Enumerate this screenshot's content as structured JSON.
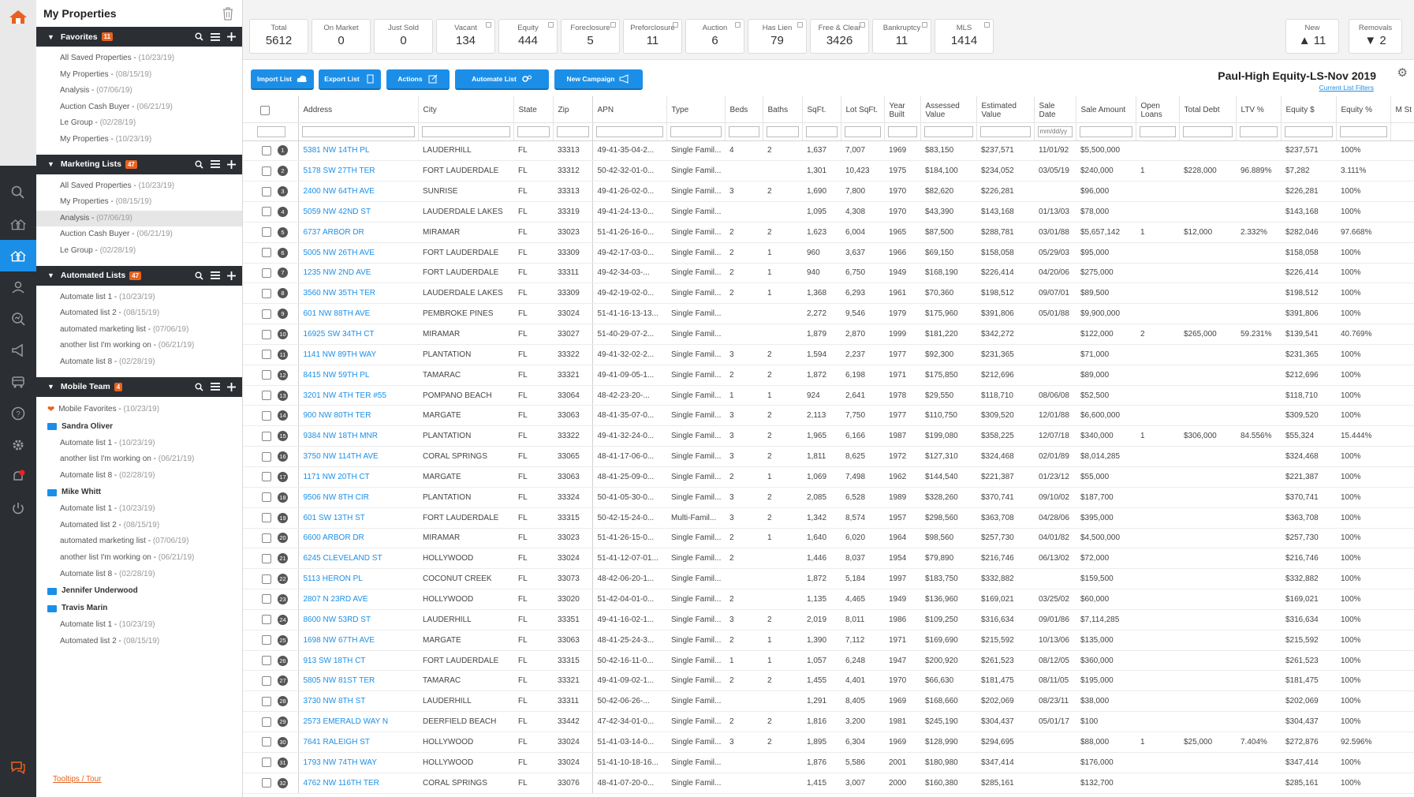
{
  "sidebar": {
    "title": "My Properties",
    "favorites": {
      "label": "Favorites",
      "badge": "11",
      "items": [
        {
          "name": "All Saved Properties",
          "date": "(10/23/19)"
        },
        {
          "name": "My Properties",
          "date": "(08/15/19)"
        },
        {
          "name": "Analysis",
          "date": "(07/06/19)"
        },
        {
          "name": "Auction Cash Buyer",
          "date": "(06/21/19)"
        },
        {
          "name": "Le Group",
          "date": "(02/28/19)"
        },
        {
          "name": "My Properties",
          "date": "(10/23/19)"
        }
      ]
    },
    "marketing": {
      "label": "Marketing Lists",
      "badge": "47",
      "items": [
        {
          "name": "All Saved Properties",
          "date": "(10/23/19)"
        },
        {
          "name": "My Properties",
          "date": "(08/15/19)"
        },
        {
          "name": "Analysis",
          "date": "(07/06/19)"
        },
        {
          "name": "Auction Cash Buyer",
          "date": "(06/21/19)"
        },
        {
          "name": "Le Group",
          "date": "(02/28/19)"
        }
      ]
    },
    "automated": {
      "label": "Automated Lists",
      "badge": "47",
      "items": [
        {
          "name": "Automate list 1",
          "date": "(10/23/19)"
        },
        {
          "name": "Automated list 2",
          "date": "(08/15/19)"
        },
        {
          "name": "automated marketing list",
          "date": "(07/06/19)"
        },
        {
          "name": "another list I'm working on",
          "date": "(06/21/19)"
        },
        {
          "name": "Automate list 8",
          "date": "(02/28/19)"
        }
      ]
    },
    "mobile": {
      "label": "Mobile Team",
      "badge": "4",
      "favorites": {
        "name": "Mobile Favorites",
        "date": "(10/23/19)"
      },
      "members": [
        {
          "name": "Sandra Oliver",
          "items": [
            {
              "name": "Automate list 1",
              "date": "(10/23/19)"
            },
            {
              "name": "another list I'm working on",
              "date": "(06/21/19)"
            },
            {
              "name": "Automate list 8",
              "date": "(02/28/19)"
            }
          ]
        },
        {
          "name": "Mike Whitt",
          "items": [
            {
              "name": "Automate list 1",
              "date": "(10/23/19)"
            },
            {
              "name": "Automated list 2",
              "date": "(08/15/19)"
            },
            {
              "name": "automated marketing list",
              "date": "(07/06/19)"
            },
            {
              "name": "another list I'm working on",
              "date": "(06/21/19)"
            },
            {
              "name": "Automate list 8",
              "date": "(02/28/19)"
            }
          ]
        },
        {
          "name": "Jennifer Underwood",
          "items": []
        },
        {
          "name": "Travis Marin",
          "items": [
            {
              "name": "Automate list 1",
              "date": "(10/23/19)"
            },
            {
              "name": "Automated list 2",
              "date": "(08/15/19)"
            }
          ]
        }
      ]
    },
    "tooltips": "Tooltips / Tour"
  },
  "stats": [
    {
      "label": "Total",
      "value": "5612",
      "ext": false
    },
    {
      "label": "On Market",
      "value": "0",
      "ext": false
    },
    {
      "label": "Just Sold",
      "value": "0",
      "ext": false
    },
    {
      "label": "Vacant",
      "value": "134",
      "ext": true
    },
    {
      "label": "Equity",
      "value": "444",
      "ext": true
    },
    {
      "label": "Foreclosure",
      "value": "5",
      "ext": true
    },
    {
      "label": "Preforclosure",
      "value": "11",
      "ext": true
    },
    {
      "label": "Auction",
      "value": "6",
      "ext": true
    },
    {
      "label": "Has Lien",
      "value": "79",
      "ext": true
    },
    {
      "label": "Free & Clear",
      "value": "3426",
      "ext": true
    },
    {
      "label": "Bankruptcy",
      "value": "11",
      "ext": true
    },
    {
      "label": "MLS",
      "value": "1414",
      "ext": true
    }
  ],
  "new_stat": {
    "label": "New",
    "value": "11",
    "arrow": "▲"
  },
  "removals_stat": {
    "label": "Removals",
    "value": "2",
    "arrow": "▼"
  },
  "toolbar": {
    "import": "Import List",
    "export": "Export List",
    "actions": "Actions",
    "automate": "Automate List",
    "campaign": "New Campaign",
    "list_title": "Paul-High Equity-LS-Nov 2019",
    "filters_link": "Current List Filters"
  },
  "columns": [
    "Address",
    "City",
    "State",
    "Zip",
    "APN",
    "Type",
    "Beds",
    "Baths",
    "SqFt.",
    "Lot SqFt.",
    "Year Built",
    "Assessed Value",
    "Estimated Value",
    "Sale Date",
    "Sale Amount",
    "Open Loans",
    "Total Debt",
    "LTV %",
    "Equity $",
    "Equity %",
    "M St"
  ],
  "filter_placeholder_sale_date": "mm/dd/yy",
  "rows": [
    [
      "1",
      "5381 NW 14TH PL",
      "LAUDERHILL",
      "FL",
      "33313",
      "49-41-35-04-2...",
      "Single Famil...",
      "4",
      "2",
      "1,637",
      "7,007",
      "1969",
      "$83,150",
      "$237,571",
      "11/01/92",
      "$5,500,000",
      "",
      "",
      "",
      "$237,571",
      "100%"
    ],
    [
      "2",
      "5178 SW 27TH TER",
      "FORT LAUDERDALE",
      "FL",
      "33312",
      "50-42-32-01-0...",
      "Single Famil...",
      "",
      "",
      "1,301",
      "10,423",
      "1975",
      "$184,100",
      "$234,052",
      "03/05/19",
      "$240,000",
      "1",
      "$228,000",
      "96.889%",
      "$7,282",
      "3.111%"
    ],
    [
      "3",
      "2400 NW 64TH AVE",
      "SUNRISE",
      "FL",
      "33313",
      "49-41-26-02-0...",
      "Single Famil...",
      "3",
      "2",
      "1,690",
      "7,800",
      "1970",
      "$82,620",
      "$226,281",
      "",
      "$96,000",
      "",
      "",
      "",
      "$226,281",
      "100%"
    ],
    [
      "4",
      "5059 NW 42ND ST",
      "LAUDERDALE LAKES",
      "FL",
      "33319",
      "49-41-24-13-0...",
      "Single Famil...",
      "",
      "",
      "1,095",
      "4,308",
      "1970",
      "$43,390",
      "$143,168",
      "01/13/03",
      "$78,000",
      "",
      "",
      "",
      "$143,168",
      "100%"
    ],
    [
      "5",
      "6737 ARBOR DR",
      "MIRAMAR",
      "FL",
      "33023",
      "51-41-26-16-0...",
      "Single Famil...",
      "2",
      "2",
      "1,623",
      "6,004",
      "1965",
      "$87,500",
      "$288,781",
      "03/01/88",
      "$5,657,142",
      "1",
      "$12,000",
      "2.332%",
      "$282,046",
      "97.668%"
    ],
    [
      "6",
      "5005 NW 26TH AVE",
      "FORT LAUDERDALE",
      "FL",
      "33309",
      "49-42-17-03-0...",
      "Single Famil...",
      "2",
      "1",
      "960",
      "3,637",
      "1966",
      "$69,150",
      "$158,058",
      "05/29/03",
      "$95,000",
      "",
      "",
      "",
      "$158,058",
      "100%"
    ],
    [
      "7",
      "1235 NW 2ND AVE",
      "FORT LAUDERDALE",
      "FL",
      "33311",
      "49-42-34-03-...",
      "Single Famil...",
      "2",
      "1",
      "940",
      "6,750",
      "1949",
      "$168,190",
      "$226,414",
      "04/20/06",
      "$275,000",
      "",
      "",
      "",
      "$226,414",
      "100%"
    ],
    [
      "8",
      "3560 NW 35TH TER",
      "LAUDERDALE LAKES",
      "FL",
      "33309",
      "49-42-19-02-0...",
      "Single Famil...",
      "2",
      "1",
      "1,368",
      "6,293",
      "1961",
      "$70,360",
      "$198,512",
      "09/07/01",
      "$89,500",
      "",
      "",
      "",
      "$198,512",
      "100%"
    ],
    [
      "9",
      "601 NW 88TH AVE",
      "PEMBROKE PINES",
      "FL",
      "33024",
      "51-41-16-13-13...",
      "Single Famil...",
      "",
      "",
      "2,272",
      "9,546",
      "1979",
      "$175,960",
      "$391,806",
      "05/01/88",
      "$9,900,000",
      "",
      "",
      "",
      "$391,806",
      "100%"
    ],
    [
      "10",
      "16925 SW 34TH CT",
      "MIRAMAR",
      "FL",
      "33027",
      "51-40-29-07-2...",
      "Single Famil...",
      "",
      "",
      "1,879",
      "2,870",
      "1999",
      "$181,220",
      "$342,272",
      "",
      "$122,000",
      "2",
      "$265,000",
      "59.231%",
      "$139,541",
      "40.769%"
    ],
    [
      "11",
      "1141 NW 89TH WAY",
      "PLANTATION",
      "FL",
      "33322",
      "49-41-32-02-2...",
      "Single Famil...",
      "3",
      "2",
      "1,594",
      "2,237",
      "1977",
      "$92,300",
      "$231,365",
      "",
      "$71,000",
      "",
      "",
      "",
      "$231,365",
      "100%"
    ],
    [
      "12",
      "8415 NW 59TH PL",
      "TAMARAC",
      "FL",
      "33321",
      "49-41-09-05-1...",
      "Single Famil...",
      "2",
      "2",
      "1,872",
      "6,198",
      "1971",
      "$175,850",
      "$212,696",
      "",
      "$89,000",
      "",
      "",
      "",
      "$212,696",
      "100%"
    ],
    [
      "13",
      "3201 NW 4TH TER #55",
      "POMPANO BEACH",
      "FL",
      "33064",
      "48-42-23-20-...",
      "Single Famil...",
      "1",
      "1",
      "924",
      "2,641",
      "1978",
      "$29,550",
      "$118,710",
      "08/06/08",
      "$52,500",
      "",
      "",
      "",
      "$118,710",
      "100%"
    ],
    [
      "14",
      "900 NW 80TH TER",
      "MARGATE",
      "FL",
      "33063",
      "48-41-35-07-0...",
      "Single Famil...",
      "3",
      "2",
      "2,113",
      "7,750",
      "1977",
      "$110,750",
      "$309,520",
      "12/01/88",
      "$6,600,000",
      "",
      "",
      "",
      "$309,520",
      "100%"
    ],
    [
      "15",
      "9384 NW 18TH MNR",
      "PLANTATION",
      "FL",
      "33322",
      "49-41-32-24-0...",
      "Single Famil...",
      "3",
      "2",
      "1,965",
      "6,166",
      "1987",
      "$199,080",
      "$358,225",
      "12/07/18",
      "$340,000",
      "1",
      "$306,000",
      "84.556%",
      "$55,324",
      "15.444%"
    ],
    [
      "16",
      "3750 NW 114TH AVE",
      "CORAL SPRINGS",
      "FL",
      "33065",
      "48-41-17-06-0...",
      "Single Famil...",
      "3",
      "2",
      "1,811",
      "8,625",
      "1972",
      "$127,310",
      "$324,468",
      "02/01/89",
      "$8,014,285",
      "",
      "",
      "",
      "$324,468",
      "100%"
    ],
    [
      "17",
      "1171 NW 20TH CT",
      "MARGATE",
      "FL",
      "33063",
      "48-41-25-09-0...",
      "Single Famil...",
      "2",
      "1",
      "1,069",
      "7,498",
      "1962",
      "$144,540",
      "$221,387",
      "01/23/12",
      "$55,000",
      "",
      "",
      "",
      "$221,387",
      "100%"
    ],
    [
      "18",
      "9506 NW 8TH CIR",
      "PLANTATION",
      "FL",
      "33324",
      "50-41-05-30-0...",
      "Single Famil...",
      "3",
      "2",
      "2,085",
      "6,528",
      "1989",
      "$328,260",
      "$370,741",
      "09/10/02",
      "$187,700",
      "",
      "",
      "",
      "$370,741",
      "100%"
    ],
    [
      "19",
      "601 SW 13TH ST",
      "FORT LAUDERDALE",
      "FL",
      "33315",
      "50-42-15-24-0...",
      "Multi-Famil...",
      "3",
      "2",
      "1,342",
      "8,574",
      "1957",
      "$298,560",
      "$363,708",
      "04/28/06",
      "$395,000",
      "",
      "",
      "",
      "$363,708",
      "100%"
    ],
    [
      "20",
      "6600 ARBOR DR",
      "MIRAMAR",
      "FL",
      "33023",
      "51-41-26-15-0...",
      "Single Famil...",
      "2",
      "1",
      "1,640",
      "6,020",
      "1964",
      "$98,560",
      "$257,730",
      "04/01/82",
      "$4,500,000",
      "",
      "",
      "",
      "$257,730",
      "100%"
    ],
    [
      "21",
      "6245 CLEVELAND ST",
      "HOLLYWOOD",
      "FL",
      "33024",
      "51-41-12-07-01...",
      "Single Famil...",
      "2",
      "",
      "1,446",
      "8,037",
      "1954",
      "$79,890",
      "$216,746",
      "06/13/02",
      "$72,000",
      "",
      "",
      "",
      "$216,746",
      "100%"
    ],
    [
      "22",
      "5113 HERON PL",
      "COCONUT CREEK",
      "FL",
      "33073",
      "48-42-06-20-1...",
      "Single Famil...",
      "",
      "",
      "1,872",
      "5,184",
      "1997",
      "$183,750",
      "$332,882",
      "",
      "$159,500",
      "",
      "",
      "",
      "$332,882",
      "100%"
    ],
    [
      "23",
      "2807 N 23RD AVE",
      "HOLLYWOOD",
      "FL",
      "33020",
      "51-42-04-01-0...",
      "Single Famil...",
      "2",
      "",
      "1,135",
      "4,465",
      "1949",
      "$136,960",
      "$169,021",
      "03/25/02",
      "$60,000",
      "",
      "",
      "",
      "$169,021",
      "100%"
    ],
    [
      "24",
      "8600 NW 53RD ST",
      "LAUDERHILL",
      "FL",
      "33351",
      "49-41-16-02-1...",
      "Single Famil...",
      "3",
      "2",
      "2,019",
      "8,011",
      "1986",
      "$109,250",
      "$316,634",
      "09/01/86",
      "$7,114,285",
      "",
      "",
      "",
      "$316,634",
      "100%"
    ],
    [
      "25",
      "1698 NW 67TH AVE",
      "MARGATE",
      "FL",
      "33063",
      "48-41-25-24-3...",
      "Single Famil...",
      "2",
      "1",
      "1,390",
      "7,112",
      "1971",
      "$169,690",
      "$215,592",
      "10/13/06",
      "$135,000",
      "",
      "",
      "",
      "$215,592",
      "100%"
    ],
    [
      "26",
      "913 SW 18TH CT",
      "FORT LAUDERDALE",
      "FL",
      "33315",
      "50-42-16-11-0...",
      "Single Famil...",
      "1",
      "1",
      "1,057",
      "6,248",
      "1947",
      "$200,920",
      "$261,523",
      "08/12/05",
      "$360,000",
      "",
      "",
      "",
      "$261,523",
      "100%"
    ],
    [
      "27",
      "5805 NW 81ST TER",
      "TAMARAC",
      "FL",
      "33321",
      "49-41-09-02-1...",
      "Single Famil...",
      "2",
      "2",
      "1,455",
      "4,401",
      "1970",
      "$66,630",
      "$181,475",
      "08/11/05",
      "$195,000",
      "",
      "",
      "",
      "$181,475",
      "100%"
    ],
    [
      "28",
      "3730 NW 8TH ST",
      "LAUDERHILL",
      "FL",
      "33311",
      "50-42-06-26-...",
      "Single Famil...",
      "",
      "",
      "1,291",
      "8,405",
      "1969",
      "$168,660",
      "$202,069",
      "08/23/11",
      "$38,000",
      "",
      "",
      "",
      "$202,069",
      "100%"
    ],
    [
      "29",
      "2573 EMERALD WAY N",
      "DEERFIELD BEACH",
      "FL",
      "33442",
      "47-42-34-01-0...",
      "Single Famil...",
      "2",
      "2",
      "1,816",
      "3,200",
      "1981",
      "$245,190",
      "$304,437",
      "05/01/17",
      "$100",
      "",
      "",
      "",
      "$304,437",
      "100%"
    ],
    [
      "30",
      "7641 RALEIGH ST",
      "HOLLYWOOD",
      "FL",
      "33024",
      "51-41-03-14-0...",
      "Single Famil...",
      "3",
      "2",
      "1,895",
      "6,304",
      "1969",
      "$128,990",
      "$294,695",
      "",
      "$88,000",
      "1",
      "$25,000",
      "7.404%",
      "$272,876",
      "92.596%"
    ],
    [
      "31",
      "1793 NW 74TH WAY",
      "HOLLYWOOD",
      "FL",
      "33024",
      "51-41-10-18-16...",
      "Single Famil...",
      "",
      "",
      "1,876",
      "5,586",
      "2001",
      "$180,980",
      "$347,414",
      "",
      "$176,000",
      "",
      "",
      "",
      "$347,414",
      "100%"
    ],
    [
      "32",
      "4762 NW 116TH TER",
      "CORAL SPRINGS",
      "FL",
      "33076",
      "48-41-07-20-0...",
      "Single Famil...",
      "",
      "",
      "1,415",
      "3,007",
      "2000",
      "$160,380",
      "$285,161",
      "",
      "$132,700",
      "",
      "",
      "",
      "$285,161",
      "100%"
    ]
  ]
}
